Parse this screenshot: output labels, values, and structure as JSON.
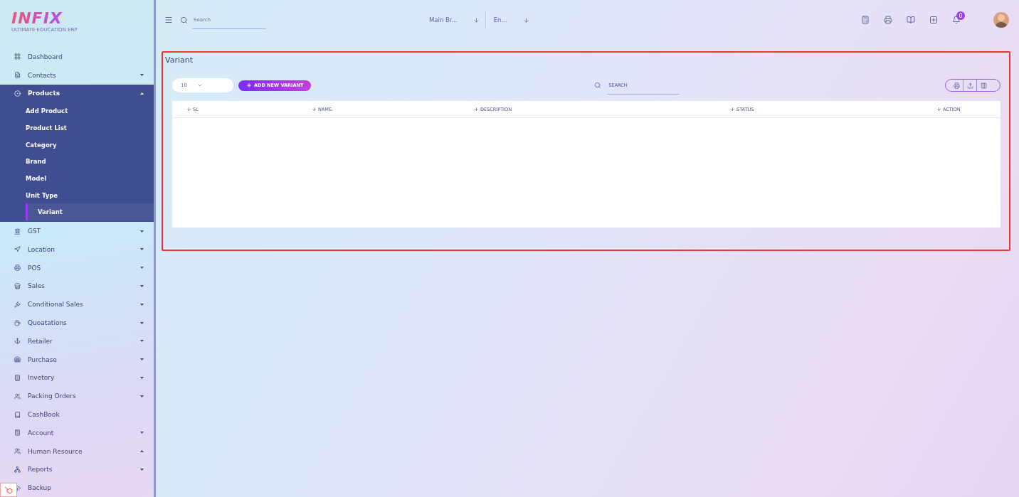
{
  "logo": {
    "name": "INFIX",
    "tagline": "ULTIMATE EDUCATION ERP"
  },
  "sidebar": {
    "items": [
      {
        "label": "Dashboard",
        "kind": "link"
      },
      {
        "label": "Contacts",
        "kind": "group",
        "expanded": false
      },
      {
        "label": "Products",
        "kind": "group",
        "expanded": true,
        "children": [
          {
            "label": "Add Product",
            "selected": false
          },
          {
            "label": "Product List",
            "selected": false
          },
          {
            "label": "Category",
            "selected": false
          },
          {
            "label": "Brand",
            "selected": false
          },
          {
            "label": "Model",
            "selected": false
          },
          {
            "label": "Unit Type",
            "selected": false
          },
          {
            "label": "Variant",
            "selected": true
          }
        ]
      },
      {
        "label": "GST",
        "kind": "group",
        "expanded": false
      },
      {
        "label": "Location",
        "kind": "group",
        "expanded": false
      },
      {
        "label": "POS",
        "kind": "group",
        "expanded": false
      },
      {
        "label": "Sales",
        "kind": "group",
        "expanded": false
      },
      {
        "label": "Conditional Sales",
        "kind": "group",
        "expanded": false
      },
      {
        "label": "Quoatations",
        "kind": "group",
        "expanded": false
      },
      {
        "label": "Retailer",
        "kind": "group",
        "expanded": false
      },
      {
        "label": "Purchase",
        "kind": "group",
        "expanded": false
      },
      {
        "label": "Invetory",
        "kind": "group",
        "expanded": false
      },
      {
        "label": "Packing Orders",
        "kind": "group",
        "expanded": false
      },
      {
        "label": "CashBook",
        "kind": "link"
      },
      {
        "label": "Account",
        "kind": "group",
        "expanded": false
      },
      {
        "label": "Human Resource",
        "kind": "group",
        "expanded": true
      },
      {
        "label": "Reports",
        "kind": "group",
        "expanded": false
      },
      {
        "label": "Backup",
        "kind": "link"
      }
    ]
  },
  "topbar": {
    "search": {
      "placeholder": "Search"
    },
    "branch": "Main Br...",
    "language": "En...",
    "notifications": "0"
  },
  "page": {
    "title": "Variant",
    "page_size": "10",
    "add_button": "ADD NEW VARIANT",
    "search": {
      "placeholder": "SEARCH"
    },
    "table": {
      "columns": [
        "SL",
        "NAME",
        "DESCRIPTION",
        "STATUS",
        "ACTION"
      ]
    }
  }
}
